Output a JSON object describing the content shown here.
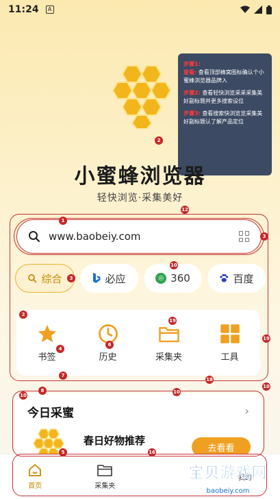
{
  "status_bar": {
    "time": "11:24",
    "small_icon": "A"
  },
  "tip_box": {
    "steps": [
      {
        "title": "步骤1:",
        "label": "查看:",
        "text": "查看顶部蜂窝图标确认个小蜜蜂浏览器品牌入"
      },
      {
        "title": "步骤2:",
        "text": "查看轻快浏览采采采集美好副标题并更多搜索设位"
      },
      {
        "title": "步骤3:",
        "text": "查看搜索快浏览览采集美好副标题认了解产品定位"
      }
    ]
  },
  "app": {
    "title": "小蜜蜂浏览器",
    "subtitle": "轻快浏览·采集美好"
  },
  "search": {
    "value": "www.baobeiy.com"
  },
  "engines": [
    {
      "label": "综合",
      "icon": "search-icon",
      "active": true
    },
    {
      "label": "必应",
      "icon": "bing-icon",
      "active": false
    },
    {
      "label": "360",
      "icon": "360-icon",
      "active": false
    },
    {
      "label": "百度",
      "icon": "baidu-icon",
      "active": false
    }
  ],
  "quick_actions": [
    {
      "label": "书签",
      "icon": "star-icon"
    },
    {
      "label": "历史",
      "icon": "clock-icon"
    },
    {
      "label": "采集夹",
      "icon": "folder-icon"
    },
    {
      "label": "工具",
      "icon": "grid-icon"
    }
  ],
  "today": {
    "title": "今日采蜜",
    "item_title": "春日好物推荐",
    "button_label": "去看看"
  },
  "bottom_nav": [
    {
      "label": "首页",
      "icon": "home-icon"
    },
    {
      "label": "采集夹",
      "icon": "folder-icon"
    },
    {
      "label": "",
      "icon": ""
    },
    {
      "label": "我的",
      "icon": "user-icon"
    }
  ],
  "annotation_markers": [
    "1",
    "2",
    "3",
    "3",
    "12",
    "10",
    "2",
    "4",
    "6",
    "19",
    "19",
    "7",
    "18",
    "10",
    "8",
    "10",
    "10",
    "5",
    "16"
  ],
  "watermark": {
    "main": "宝贝游戏网",
    "sub": "baobeiy.com"
  },
  "colors": {
    "accent": "#f0a020",
    "annotation_red": "#c63338",
    "tip_bg": "#3c4a63"
  }
}
